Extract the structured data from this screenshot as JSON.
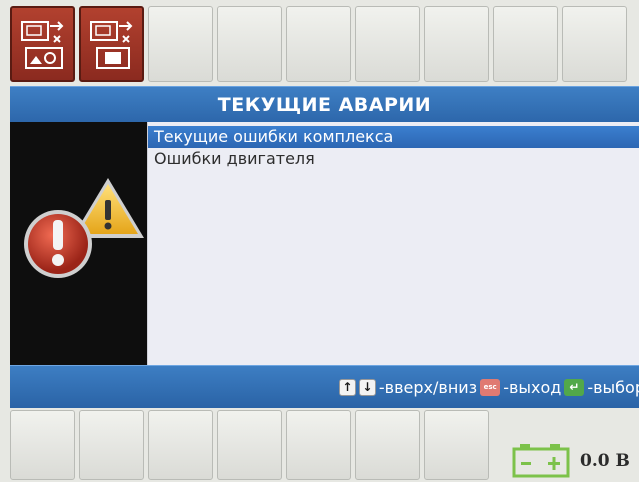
{
  "header": {
    "title": "ТЕКУЩИЕ АВАРИИ"
  },
  "list": {
    "items": [
      {
        "label": "Текущие ошибки комплекса",
        "selected": true
      },
      {
        "label": "Ошибки двигателя",
        "selected": false
      }
    ]
  },
  "hints": {
    "nav_text": "-вверх/вниз",
    "esc_key": "esc",
    "exit_text": "-выход",
    "select_text": "-выбор"
  },
  "status": {
    "battery_value": "0.0 В"
  },
  "icons": {
    "top_key_1": "diagnostics-camera-icon",
    "top_key_2": "diagnostics-device-icon",
    "alarm": "alarm-warning-icon",
    "battery": "battery-icon"
  },
  "colors": {
    "accent_blue": "#2d67ab",
    "softkey_red": "#9b3225",
    "panel_black": "#0e0e0e",
    "enter_green": "#52a84a",
    "esc_red": "#e07a72"
  }
}
